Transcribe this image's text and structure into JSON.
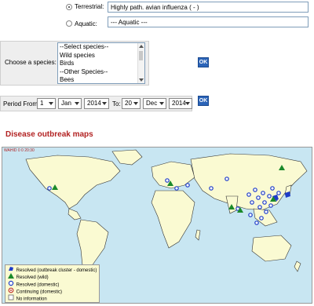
{
  "animal_type": {
    "terrestrial_label": "Terrestrial:",
    "terrestrial_value": "Highly path. avian influenza ( - )",
    "aquatic_label": "Aquatic:",
    "aquatic_value": "--- Aquatic ---"
  },
  "species": {
    "label": "Choose a species:",
    "options": [
      "--Select species--",
      "Wild species",
      "Birds",
      "--Other Species--",
      "Bees"
    ],
    "ok": "OK"
  },
  "period": {
    "from_label": "Period From :",
    "from_day": "1",
    "from_month": "Jan",
    "from_year": "2014",
    "to_label": "To:",
    "to_day": "20",
    "to_month": "Dec",
    "to_year": "2014",
    "ok": "OK"
  },
  "section_title": "Disease outbreak maps",
  "map": {
    "watermark": "WAHID 0 0 20:30",
    "ocean_color": "#c8e6f2",
    "land_color": "#fafad2",
    "marker_color": "#1e3cc8",
    "wild_color": "#1a8a2a",
    "legend": [
      {
        "symbol": "cluster",
        "label": "Resolved (outbreak cluster - domestic)"
      },
      {
        "symbol": "triangle",
        "label": "Resolved (wild)"
      },
      {
        "symbol": "circle",
        "label": "Resolved (domestic)"
      },
      {
        "symbol": "continuing",
        "label": "Continuing (domestic)"
      },
      {
        "symbol": "none",
        "label": "No information"
      }
    ]
  }
}
